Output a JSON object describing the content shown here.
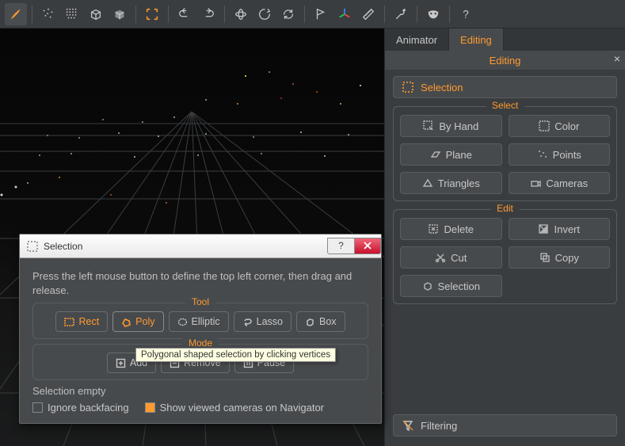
{
  "toolbar": {
    "items": [
      {
        "name": "brush-icon",
        "active": true
      },
      {
        "name": "sep"
      },
      {
        "name": "points-sparse-icon"
      },
      {
        "name": "points-dense-icon"
      },
      {
        "name": "cube-wire-icon"
      },
      {
        "name": "cube-solid-icon"
      },
      {
        "name": "sep"
      },
      {
        "name": "bracket-select-icon",
        "color": "#ff9a2e"
      },
      {
        "name": "sep"
      },
      {
        "name": "undo-icon"
      },
      {
        "name": "redo-icon"
      },
      {
        "name": "sep"
      },
      {
        "name": "orbit-icon"
      },
      {
        "name": "rotate-icon"
      },
      {
        "name": "refresh-icon"
      },
      {
        "name": "sep"
      },
      {
        "name": "flag-icon"
      },
      {
        "name": "axes-icon",
        "multicolor": true
      },
      {
        "name": "ruler-icon"
      },
      {
        "name": "sep"
      },
      {
        "name": "wrench-icon"
      },
      {
        "name": "sep"
      },
      {
        "name": "mask-icon"
      },
      {
        "name": "sep"
      },
      {
        "name": "help-icon"
      }
    ]
  },
  "tabs": {
    "items": [
      "Animator",
      "Editing"
    ],
    "active": 1
  },
  "panel": {
    "title": "Editing",
    "selection_row": "Selection",
    "select": {
      "legend": "Select",
      "buttons": [
        "By Hand",
        "Color",
        "Plane",
        "Points",
        "Triangles",
        "Cameras"
      ]
    },
    "edit": {
      "legend": "Edit",
      "buttons": [
        "Delete",
        "Invert",
        "Cut",
        "Copy",
        "Selection"
      ]
    },
    "filtering": "Filtering"
  },
  "dialog": {
    "title": "Selection",
    "instruction": "Press the left mouse button to define the top left corner, then drag and release.",
    "tool": {
      "legend": "Tool",
      "buttons": [
        "Rect",
        "Poly",
        "Elliptic",
        "Lasso",
        "Box"
      ],
      "active": 1,
      "tooltip": "Polygonal shaped selection by clicking vertices"
    },
    "mode": {
      "legend": "Mode",
      "buttons": [
        "Add",
        "Remove",
        "Pause"
      ]
    },
    "status": "Selection empty",
    "checkboxes": {
      "ignore_backfacing": {
        "label": "Ignore backfacing",
        "checked": false
      },
      "show_cameras": {
        "label": "Show viewed cameras on Navigator",
        "checked": true
      }
    }
  }
}
